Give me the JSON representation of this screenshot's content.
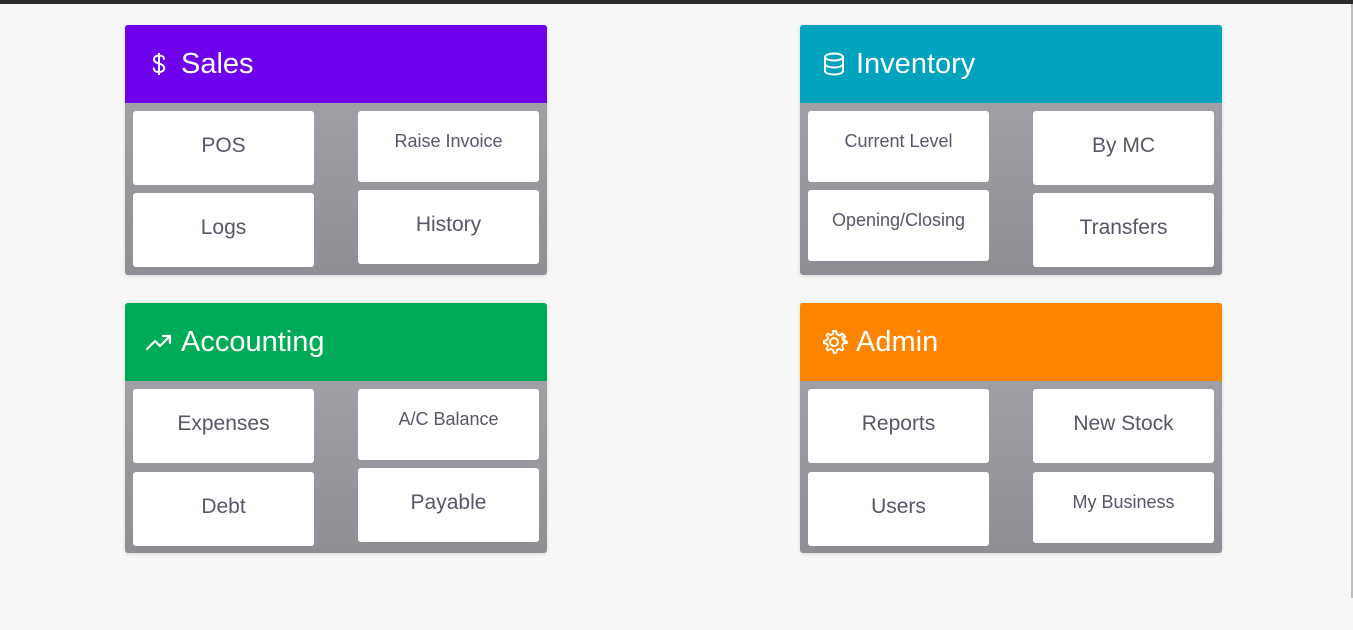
{
  "colors": {
    "sales": "#6f00ee",
    "inventory": "#00a3be",
    "accounting": "#00ab58",
    "admin": "#ff8400"
  },
  "panels": {
    "sales": {
      "title": "Sales",
      "icon": "dollar-icon",
      "tiles": [
        "POS",
        "Raise Invoice",
        "Logs",
        "History"
      ]
    },
    "inventory": {
      "title": "Inventory",
      "icon": "database-icon",
      "tiles": [
        "Current Level",
        "By MC",
        "Opening/Closing",
        "Transfers"
      ]
    },
    "accounting": {
      "title": "Accounting",
      "icon": "trending-up-icon",
      "tiles": [
        "Expenses",
        "A/C Balance",
        "Debt",
        "Payable"
      ]
    },
    "admin": {
      "title": "Admin",
      "icon": "gear-icon",
      "tiles": [
        "Reports",
        "New Stock",
        "Users",
        "My Business"
      ]
    }
  }
}
